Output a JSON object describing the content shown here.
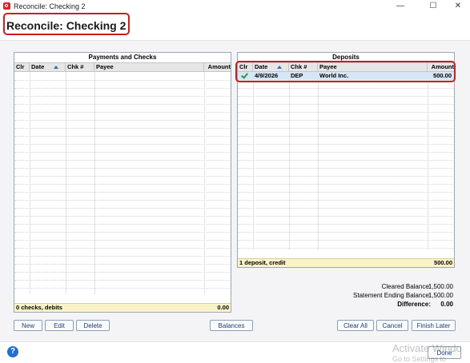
{
  "window": {
    "title": "Reconcile: Checking 2",
    "controls": [
      "—",
      "☐",
      "✕"
    ]
  },
  "header": {
    "title": "Reconcile: Checking 2"
  },
  "payments": {
    "title": "Payments and Checks",
    "columns": [
      "Clr",
      "Date",
      "Chk #",
      "Payee",
      "Amount"
    ],
    "footer_label": "0 checks, debits",
    "footer_total": "0.00"
  },
  "deposits": {
    "title": "Deposits",
    "columns": [
      "Clr",
      "Date",
      "Chk #",
      "Payee",
      "Amount"
    ],
    "rows": [
      {
        "cleared": true,
        "date": "4/9/2026",
        "chk": "DEP",
        "payee": "World Inc.",
        "amount": "500.00"
      }
    ],
    "footer_label": "1 deposit, credit",
    "footer_total": "500.00"
  },
  "summary": {
    "cleared_label": "Cleared Balance:",
    "cleared_value": "1,500.00",
    "ending_label": "Statement Ending Balance:",
    "ending_value": "1,500.00",
    "difference_label": "Difference:",
    "difference_value": "0.00"
  },
  "buttons": {
    "new": "New",
    "edit": "Edit",
    "delete": "Delete",
    "balances": "Balances",
    "clear_all": "Clear All",
    "cancel": "Cancel",
    "finish_later": "Finish Later",
    "done": "Done"
  },
  "help": "?",
  "watermark": {
    "line1": "Activate Windo",
    "line2": "Go to Settings to"
  }
}
